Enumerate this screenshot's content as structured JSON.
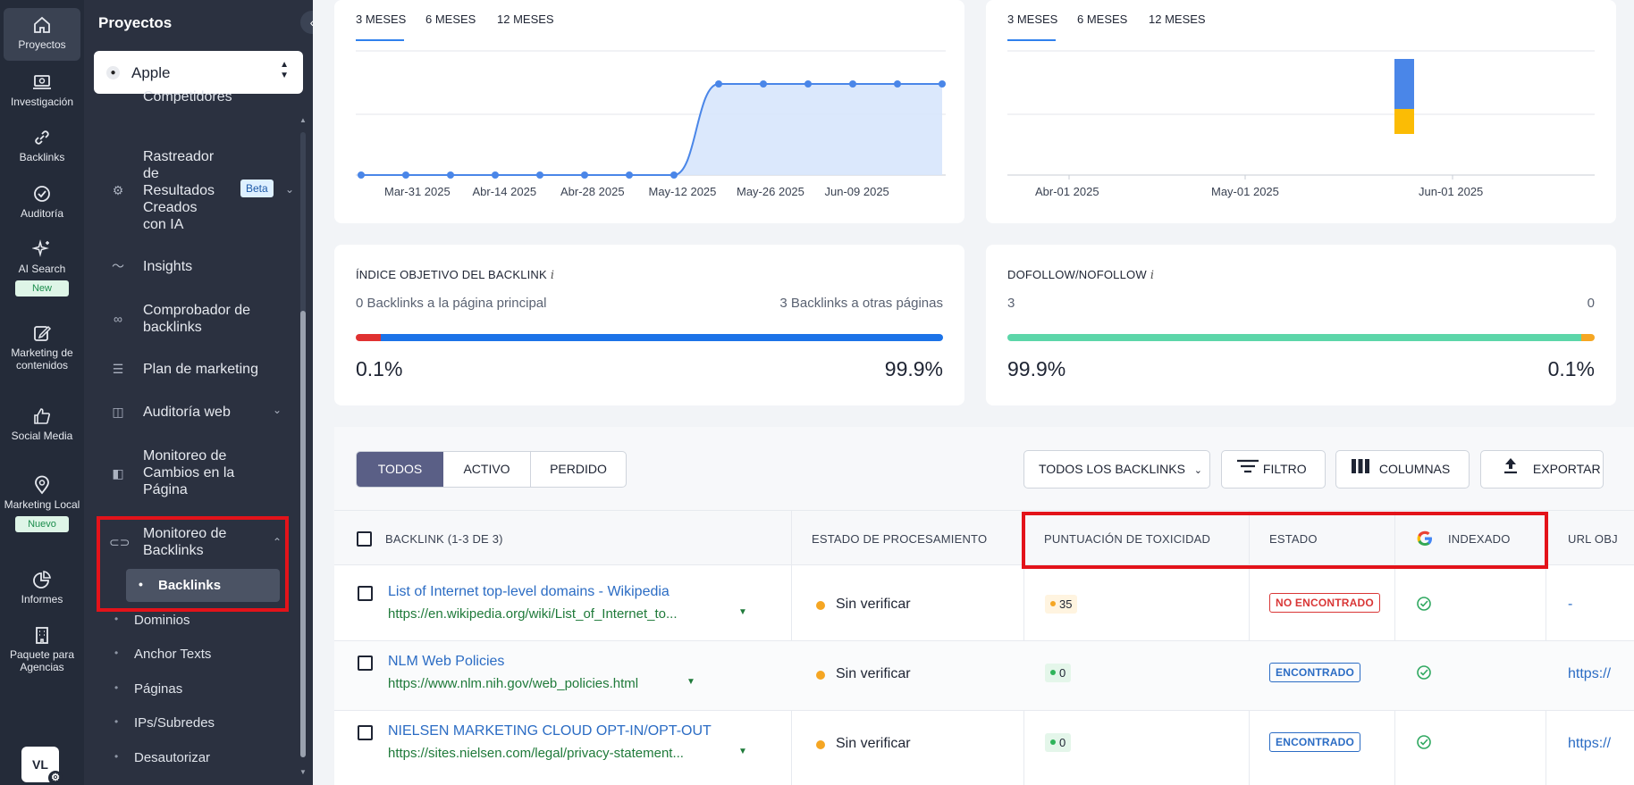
{
  "rail": {
    "items": [
      {
        "label": "Proyectos",
        "icon": "home-icon"
      },
      {
        "label": "Investigación",
        "icon": "research-icon"
      },
      {
        "label": "Backlinks",
        "icon": "link-icon"
      },
      {
        "label": "Auditoría",
        "icon": "check-circle-icon"
      },
      {
        "label": "AI Search",
        "icon": "sparkle-icon",
        "badge": "New"
      },
      {
        "label": "Marketing de contenidos",
        "icon": "edit-icon"
      },
      {
        "label": "Social Media",
        "icon": "thumbs-up-icon"
      },
      {
        "label": "Marketing Local",
        "icon": "location-pin-icon",
        "badge": "Nuevo"
      },
      {
        "label": "Informes",
        "icon": "pie-chart-icon"
      },
      {
        "label": "Paquete para Agencias",
        "icon": "building-icon"
      }
    ],
    "avatar": "VL"
  },
  "panel": {
    "title": "Proyectos",
    "project": "Apple",
    "cut_item": "Competidores",
    "items": [
      {
        "label": "Rastreador de Resultados Creados con IA",
        "icon": "ai-tracker-icon",
        "badge": "Beta"
      },
      {
        "label": "Insights",
        "icon": "insights-icon"
      },
      {
        "label": "Comprobador de backlinks",
        "icon": "link-check-icon"
      },
      {
        "label": "Plan de marketing",
        "icon": "plan-icon"
      },
      {
        "label": "Auditoría web",
        "icon": "web-audit-icon"
      },
      {
        "label": "Monitoreo de Cambios en la Página",
        "icon": "page-changes-icon"
      },
      {
        "label": "Monitoreo de Backlinks",
        "icon": "backlink-monitor-icon"
      }
    ],
    "sub_items": [
      "Backlinks",
      "Dominios",
      "Anchor Texts",
      "Páginas",
      "IPs/Subredes",
      "Desautorizar"
    ]
  },
  "chart_left": {
    "tabs": [
      "3 MESES",
      "6 MESES",
      "12 MESES"
    ],
    "selected_tab": "3 MESES",
    "chart_data": {
      "type": "area",
      "x_ticks": [
        "Mar-31 2025",
        "Abr-14 2025",
        "Abr-28 2025",
        "May-12 2025",
        "May-26 2025",
        "Jun-09 2025"
      ],
      "values": [
        0,
        0,
        0,
        0,
        0,
        0,
        0,
        0,
        1,
        1,
        1,
        1,
        1,
        1
      ],
      "color": "#4a86e8"
    }
  },
  "chart_right": {
    "tabs": [
      "3 MESES",
      "6 MESES",
      "12 MESES"
    ],
    "selected_tab": "3 MESES",
    "chart_data": {
      "type": "bar",
      "x_ticks": [
        "Abr-01 2025",
        "May-01 2025",
        "Jun-01 2025"
      ],
      "stacked_bar": {
        "position": "late May 2025",
        "segments": [
          {
            "value": 2,
            "color": "#4a86e8"
          },
          {
            "value": 1,
            "color": "#fbbc05"
          }
        ]
      }
    }
  },
  "metric_index": {
    "title": "ÍNDICE OBJETIVO DEL BACKLINK",
    "left_sub": "0 Backlinks a la página principal",
    "right_sub": "3 Backlinks a otras páginas",
    "left_value": "0.1%",
    "right_value": "99.9%",
    "left_fraction": 0.001,
    "left_color": "#e03131",
    "right_color": "#1c73e8"
  },
  "metric_follow": {
    "title": "DOFOLLOW/NOFOLLOW",
    "left_sub": "3",
    "right_sub": "0",
    "left_value": "99.9%",
    "right_value": "0.1%",
    "left_fraction": 0.999,
    "left_color": "#5cd6a9",
    "right_color": "#f5a623"
  },
  "table": {
    "segments": [
      "TODOS",
      "ACTIVO",
      "PERDIDO"
    ],
    "selected_segment": "TODOS",
    "buttons": {
      "all_backlinks": "TODOS LOS BACKLINKS",
      "filter": "FILTRO",
      "columns": "COLUMNAS",
      "export": "EXPORTAR"
    },
    "headers": {
      "backlink": "BACKLINK (1-3 DE 3)",
      "processing": "ESTADO DE PROCESAMIENTO",
      "toxicity": "PUNTUACIÓN DE TOXICIDAD",
      "status": "ESTADO",
      "indexed": "INDEXADO",
      "url": "URL OBJ"
    },
    "rows": [
      {
        "title": "List of Internet top-level domains - Wikipedia",
        "url": "https://en.wikipedia.org/wiki/List_of_Internet_to...",
        "processing": "Sin verificar",
        "toxicity": "35",
        "status": "NO ENCONTRADO",
        "target": "-"
      },
      {
        "title": "NLM Web Policies",
        "url": "https://www.nlm.nih.gov/web_policies.html",
        "processing": "Sin verificar",
        "toxicity": "0",
        "status": "ENCONTRADO",
        "target": "https://"
      },
      {
        "title": "NIELSEN MARKETING CLOUD OPT-IN/OPT-OUT",
        "url": "https://sites.nielsen.com/legal/privacy-statement...",
        "processing": "Sin verificar",
        "toxicity": "0",
        "status": "ENCONTRADO",
        "target": "https://"
      }
    ]
  }
}
